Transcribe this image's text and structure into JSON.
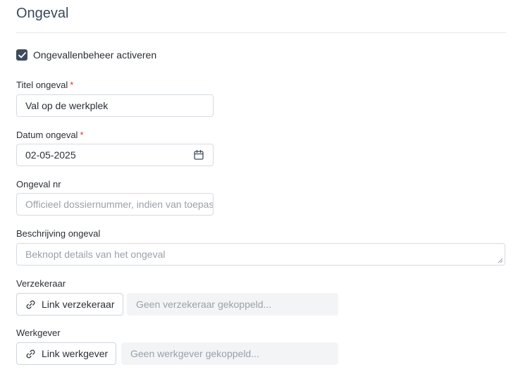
{
  "section": {
    "title": "Ongeval"
  },
  "activate": {
    "label": "Ongevallenbeheer activeren",
    "checked": true
  },
  "title_field": {
    "label": "Titel ongeval",
    "required_mark": "*",
    "value": "Val op de werkplek"
  },
  "date_field": {
    "label": "Datum ongeval",
    "required_mark": "*",
    "value": "02-05-2025",
    "icon": "calendar-icon"
  },
  "number_field": {
    "label": "Ongeval nr",
    "placeholder": "Officieel dossiernummer, indien van toepassing"
  },
  "description_field": {
    "label": "Beschrijving ongeval",
    "placeholder": "Beknopt details van het ongeval"
  },
  "insurer": {
    "label": "Verzekeraar",
    "button_label": "Link verzekeraar",
    "status": "Geen verzekeraar gekoppeld...",
    "icon": "link-icon"
  },
  "employer": {
    "label": "Werkgever",
    "button_label": "Link werkgever",
    "status": "Geen werkgever gekoppeld...",
    "icon": "link-icon"
  },
  "colors": {
    "accent": "#3d4b5c",
    "required": "#d63a3a",
    "placeholder": "#9aa1aa",
    "border": "#d6dbe1",
    "muted_bg": "#f3f4f6"
  }
}
